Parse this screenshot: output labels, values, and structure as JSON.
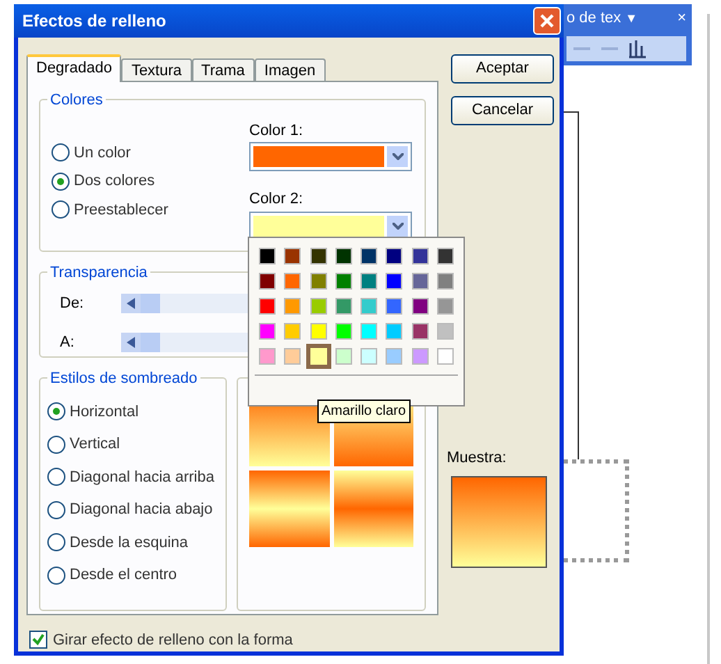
{
  "background_toolbar": {
    "title": "o de tex",
    "menu_glyph": "▼",
    "close_glyph": "×"
  },
  "window": {
    "title": "Efectos de relleno"
  },
  "tabs": [
    {
      "label": "Degradado",
      "selected": true
    },
    {
      "label": "Textura",
      "selected": false
    },
    {
      "label": "Trama",
      "selected": false
    },
    {
      "label": "Imagen",
      "selected": false
    }
  ],
  "colors_group": {
    "title": "Colores",
    "options": [
      {
        "label": "Un color",
        "selected": false
      },
      {
        "label": "Dos colores",
        "selected": true
      },
      {
        "label": "Preestablecer",
        "selected": false
      }
    ],
    "color_1": {
      "label": "Color 1:",
      "color": "#ff6600"
    },
    "color_2": {
      "label": "Color 2:",
      "color": "#ffff99"
    }
  },
  "transparency": {
    "title": "Transparencia",
    "sliders": [
      {
        "label": "De:",
        "level": 0
      },
      {
        "label": "A:",
        "level": 0
      }
    ]
  },
  "shading_styles": {
    "title": "Estilos de sombreado",
    "options": [
      {
        "label": "Horizontal",
        "selected": true
      },
      {
        "label": "Vertical",
        "selected": false
      },
      {
        "label": "Diagonal hacia arriba",
        "selected": false
      },
      {
        "label": "Diagonal hacia abajo",
        "selected": false
      },
      {
        "label": "Desde la esquina",
        "selected": false
      },
      {
        "label": "Desde el centro",
        "selected": false
      }
    ]
  },
  "variants": [
    {
      "kind": "down"
    },
    {
      "kind": "up"
    },
    {
      "kind": "band"
    },
    {
      "kind": "center"
    }
  ],
  "buttons": [
    "Aceptar",
    "Cancelar"
  ],
  "sample": {
    "label": "Muestra:"
  },
  "rotate_checkbox": {
    "label": "Girar efecto de relleno con la forma",
    "checked": true
  },
  "palette": {
    "swatches": [
      {
        "color": "#000000",
        "selected": false
      },
      {
        "color": "#993300",
        "selected": false
      },
      {
        "color": "#333300",
        "selected": false
      },
      {
        "color": "#003300",
        "selected": false
      },
      {
        "color": "#003366",
        "selected": false
      },
      {
        "color": "#000080",
        "selected": false
      },
      {
        "color": "#333399",
        "selected": false
      },
      {
        "color": "#333333",
        "selected": false
      },
      {
        "color": "#800000",
        "selected": false
      },
      {
        "color": "#ff6600",
        "selected": false
      },
      {
        "color": "#808000",
        "selected": false
      },
      {
        "color": "#008000",
        "selected": false
      },
      {
        "color": "#008080",
        "selected": false
      },
      {
        "color": "#0000ff",
        "selected": false
      },
      {
        "color": "#666699",
        "selected": false
      },
      {
        "color": "#808080",
        "selected": false
      },
      {
        "color": "#ff0000",
        "selected": false
      },
      {
        "color": "#ff9900",
        "selected": false
      },
      {
        "color": "#99cc00",
        "selected": false
      },
      {
        "color": "#339966",
        "selected": false
      },
      {
        "color": "#33cccc",
        "selected": false
      },
      {
        "color": "#3366ff",
        "selected": false
      },
      {
        "color": "#800080",
        "selected": false
      },
      {
        "color": "#969696",
        "selected": false
      },
      {
        "color": "#ff00ff",
        "selected": false
      },
      {
        "color": "#ffcc00",
        "selected": false
      },
      {
        "color": "#ffff00",
        "selected": false
      },
      {
        "color": "#00ff00",
        "selected": false
      },
      {
        "color": "#00ffff",
        "selected": false
      },
      {
        "color": "#00ccff",
        "selected": false
      },
      {
        "color": "#993366",
        "selected": false
      },
      {
        "color": "#c0c0c0",
        "selected": false
      },
      {
        "color": "#ff99cc",
        "selected": false
      },
      {
        "color": "#ffcc99",
        "selected": false
      },
      {
        "color": "#ffff99",
        "selected": true
      },
      {
        "color": "#ccffcc",
        "selected": false
      },
      {
        "color": "#ccffff",
        "selected": false
      },
      {
        "color": "#99ccff",
        "selected": false
      },
      {
        "color": "#cc99ff",
        "selected": false
      },
      {
        "color": "#ffffff",
        "selected": false
      }
    ],
    "tooltip": "Amarillo claro"
  }
}
